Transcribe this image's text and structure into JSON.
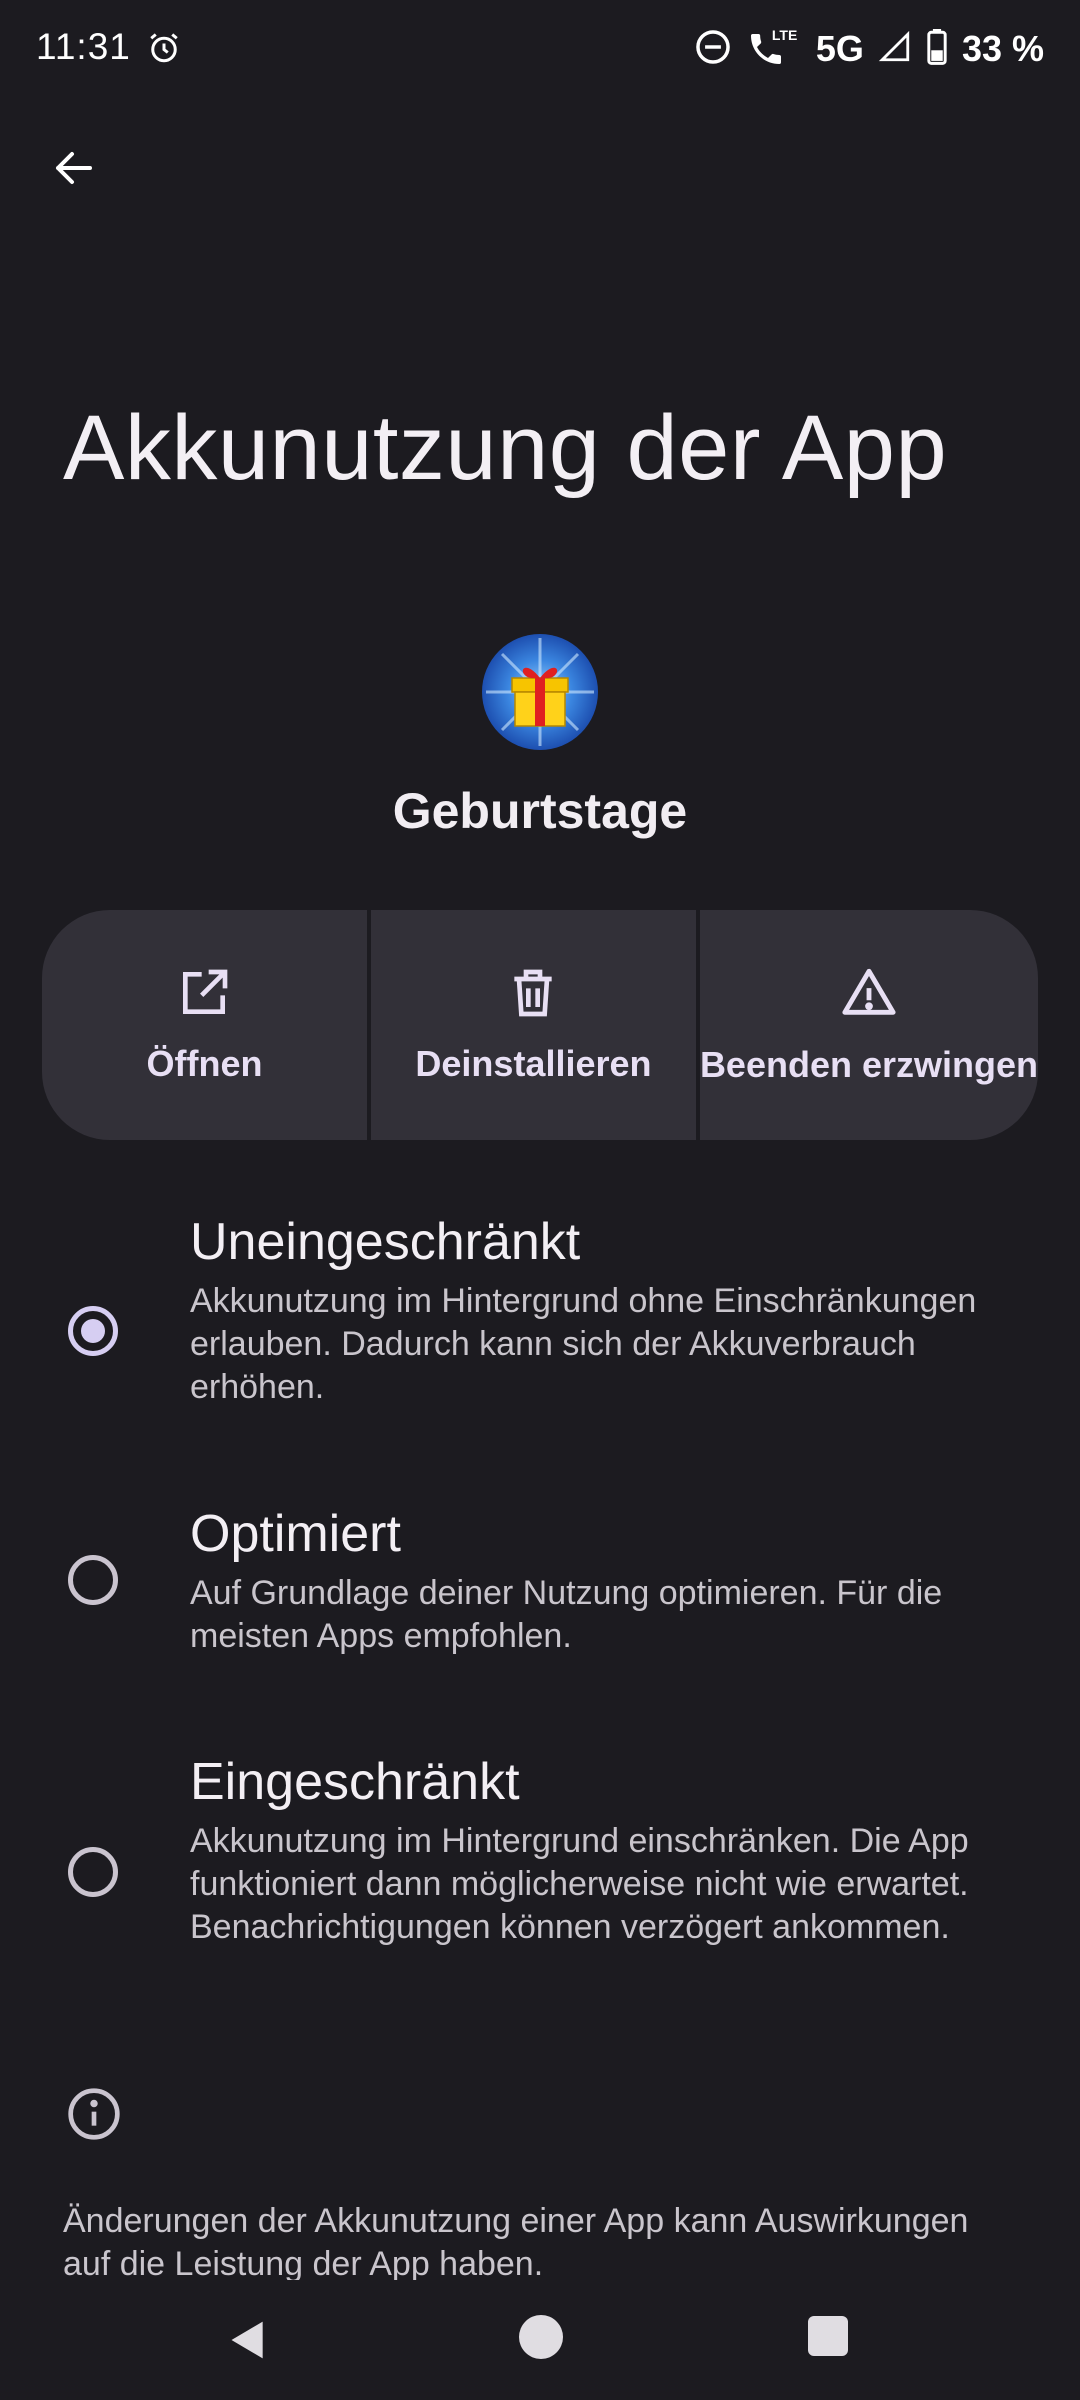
{
  "status_bar": {
    "time": "11:31",
    "network": "5G",
    "lte_label": "LTE",
    "battery": "33 %",
    "icons": [
      "alarm-icon",
      "do-not-disturb-icon",
      "wifi-calling-icon",
      "signal-icon",
      "battery-icon"
    ]
  },
  "page": {
    "title": "Akkunutzung der App"
  },
  "app": {
    "name": "Geburtstage",
    "icon": "gift-app-icon"
  },
  "actions": [
    {
      "label": "Öffnen",
      "icon": "open-external-icon"
    },
    {
      "label": "Deinstallieren",
      "icon": "trash-icon"
    },
    {
      "label": "Beenden erzwingen",
      "icon": "warning-icon"
    }
  ],
  "options": [
    {
      "title": "Uneingeschränkt",
      "description": "Akkunutzung im Hintergrund ohne Einschränkungen erlauben. Dadurch kann sich der Akkuverbrauch erhöhen.",
      "selected": true
    },
    {
      "title": "Optimiert",
      "description": "Auf Grundlage deiner Nutzung optimieren. Für die meisten Apps empfohlen.",
      "selected": false
    },
    {
      "title": "Eingeschränkt",
      "description": "Akkunutzung im Hintergrund einschränken. Die App funktioniert dann möglicherweise nicht wie erwartet. Benachrichtigungen können verzögert ankommen.",
      "selected": false
    }
  ],
  "footer": {
    "text": "Änderungen der Akkunutzung einer App kann Auswirkungen auf die Leistung der App haben."
  },
  "colors": {
    "background": "#1c1b20",
    "surface": "#323038",
    "accent": "#d6cef2",
    "text_primary": "#f3eff4",
    "text_secondary": "#c9c5cc"
  }
}
